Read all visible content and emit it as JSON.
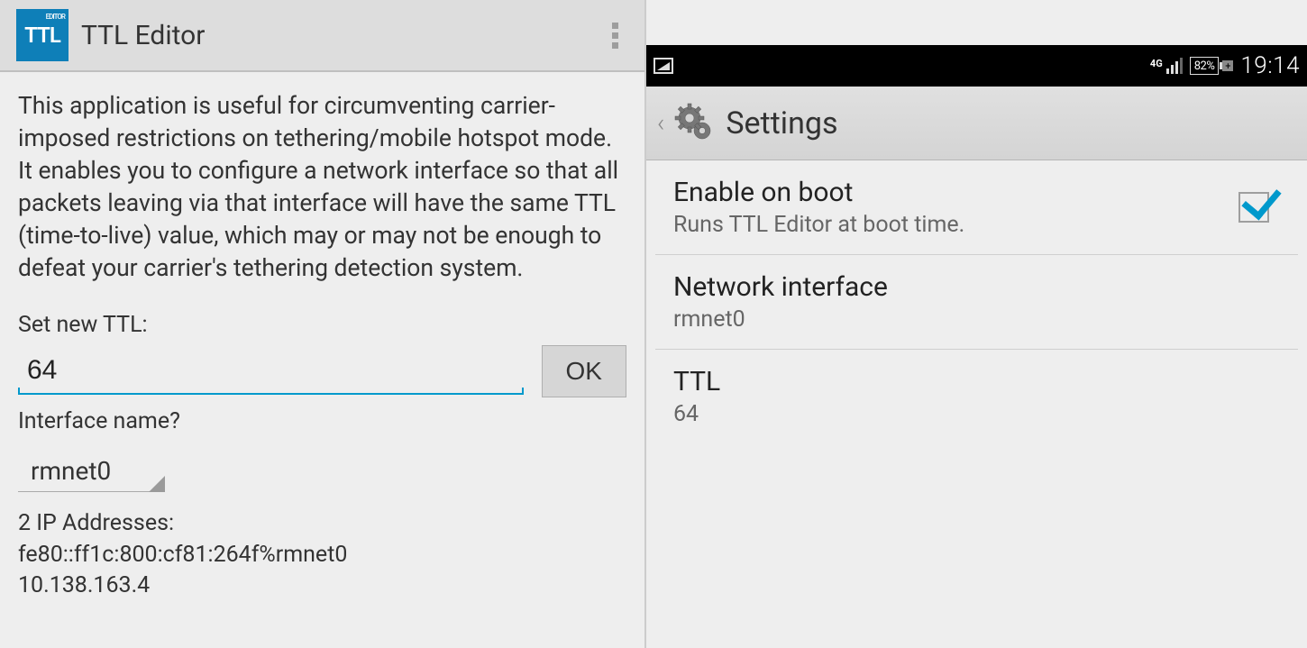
{
  "left": {
    "app_title": "TTL Editor",
    "logo_main": "TTL",
    "logo_sub": "EDITOR",
    "description": "This application is useful for circumventing carrier-imposed restrictions on tethering/mobile hotspot mode. It enables you to configure a network interface so that all packets leaving via that interface will have the same TTL (time-to-live) value, which may or may not be enough to defeat your carrier's tethering detection system.",
    "ttl_label": "Set new TTL:",
    "ttl_value": "64",
    "ok_label": "OK",
    "iface_label": "Interface name?",
    "iface_value": "rmnet0",
    "ip_header": "2 IP Addresses:",
    "ip1": "fe80::ff1c:800:cf81:264f%rmnet0",
    "ip2": "10.138.163.4"
  },
  "right": {
    "status": {
      "net_type": "4G",
      "battery": "82%",
      "clock": "19:14"
    },
    "header_title": "Settings",
    "items": [
      {
        "title": "Enable on boot",
        "summary": "Runs TTL Editor at boot time.",
        "checked": true
      },
      {
        "title": "Network interface",
        "summary": "rmnet0"
      },
      {
        "title": "TTL",
        "summary": "64"
      }
    ]
  }
}
